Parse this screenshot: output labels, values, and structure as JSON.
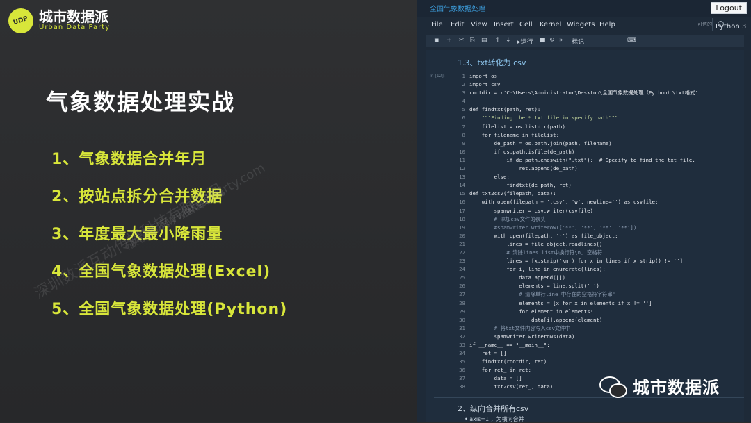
{
  "brand": {
    "name_cn": "城市数据派",
    "name_en": "Urban Data Party"
  },
  "slide": {
    "title": "气象数据处理实战",
    "items": [
      "1、气象数据合并年月",
      "2、按站点拆分合并数据",
      "3、年度最大最小降雨量",
      "4、全国气象数据处理(Excel)",
      "5、全国气象数据处理(Python)"
    ]
  },
  "watermark": {
    "line1": "深圳数派互动传媒科技有限公司",
    "line2": "版权所有，盗版必究",
    "line3": "www.udparty.com"
  },
  "notebook": {
    "title": "全国气象数据处理",
    "logout": "Logout",
    "menu": [
      "File",
      "Edit",
      "View",
      "Insert",
      "Cell",
      "Kernel",
      "Widgets",
      "Help"
    ],
    "trusted": "可信的",
    "kernel": "Python 3",
    "toolbar": {
      "run": "运行",
      "mark": "标记"
    },
    "cell_heading": "1.3、txt转化为 csv",
    "prompt": "In [12]:",
    "code": [
      "import os",
      "import csv",
      "rootdir = r'C:\\Users\\Administrator\\Desktop\\全国气象数据处理（Python）\\txt格式'",
      "",
      "def findtxt(path, ret):",
      "    \"\"\"Finding the *.txt file in specify path\"\"\"",
      "    filelist = os.listdir(path)",
      "    for filename in filelist:",
      "        de_path = os.path.join(path, filename)",
      "        if os.path.isfile(de_path):",
      "            if de_path.endswith(\".txt\"):  # Specify to find the txt file.",
      "                ret.append(de_path)",
      "        else:",
      "            findtxt(de_path, ret)",
      "def txt2csv(filepath, data):",
      "    with open(filepath + '.csv', 'w', newline='') as csvfile:",
      "        spamwriter = csv.writer(csvfile)",
      "        # 添加csv文件的表头",
      "        #spamwriter.writerow(['**', '**', '**', '**'])",
      "        with open(filepath, 'r') as file_object:",
      "            lines = file_object.readlines()",
      "            # 清除lines list中换行符\\n, 空格符'",
      "            lines = [x.strip('\\n') for x in lines if x.strip() != '']",
      "            for i, line in enumerate(lines):",
      "                data.append([])",
      "                elements = line.split(' ')",
      "                # 清除单行line 中存在的空格符字符串''",
      "                elements = [x for x in elements if x != '']",
      "                for element in elements:",
      "                    data[i].append(element)",
      "        # 将txt文件内容写入csv文件中",
      "        spamwriter.writerows(data)",
      "if __name__ == \"__main__\":",
      "    ret = []",
      "    findtxt(rootdir, ret)",
      "    for ret_ in ret:",
      "        data = []",
      "        txt2csv(ret_, data)"
    ],
    "next_heading": "2、纵向合并所有csv",
    "next_text": "• axis=1 ，为横向合并"
  },
  "footer": {
    "wechat_label": "城市数据派"
  },
  "colors": {
    "accent": "#d8e63a",
    "bg": "#2a2b2d",
    "notebook_bg": "#1e2a38"
  }
}
